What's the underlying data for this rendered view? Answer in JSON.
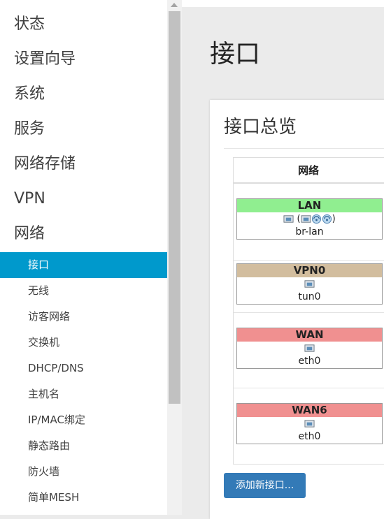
{
  "sidebar": {
    "menu": [
      "状态",
      "设置向导",
      "系统",
      "服务",
      "网络存储",
      "VPN",
      "网络"
    ],
    "submenu": [
      "接口",
      "无线",
      "访客网络",
      "交换机",
      "DHCP/DNS",
      "主机名",
      "IP/MAC绑定",
      "静态路由",
      "防火墙",
      "简单MESH"
    ],
    "active": "接口"
  },
  "page": {
    "title": "接口"
  },
  "panel": {
    "title": "接口总览",
    "column_header": "网络",
    "add_button": "添加新接口..."
  },
  "interfaces": [
    {
      "name": "LAN",
      "color": "#90ee90",
      "icons": [
        "port-icon",
        "bridge-open-paren",
        "port-icon",
        "wifi-icon",
        "wifi-icon",
        "bridge-close-paren"
      ],
      "paren_open": "(",
      "paren_close": ")",
      "device": "br-lan"
    },
    {
      "name": "VPN0",
      "color": "#d2bd9e",
      "icons": [
        "port-icon"
      ],
      "device": "tun0"
    },
    {
      "name": "WAN",
      "color": "#f09090",
      "icons": [
        "port-icon"
      ],
      "device": "eth0"
    },
    {
      "name": "WAN6",
      "color": "#f09090",
      "icons": [
        "port-icon"
      ],
      "device": "eth0"
    }
  ]
}
